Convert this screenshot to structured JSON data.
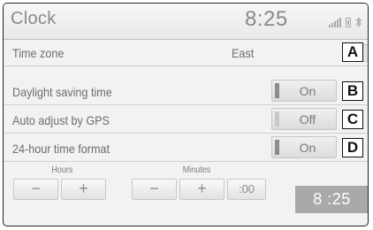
{
  "header": {
    "title": "Clock",
    "time": "8:25",
    "status_icons": [
      "signal-bars-icon",
      "phone-battery-icon",
      "bluetooth-icon"
    ]
  },
  "rows": [
    {
      "label": "Time zone",
      "value": "East",
      "callout": "A"
    },
    {
      "label": "Daylight saving time",
      "toggle": "On",
      "toggle_state": true,
      "callout": "B"
    },
    {
      "label": "Auto adjust by GPS",
      "toggle": "Off",
      "toggle_state": false,
      "callout": "C"
    },
    {
      "label": "24-hour time format",
      "toggle": "On",
      "toggle_state": true,
      "callout": "D"
    }
  ],
  "adjust": {
    "hours_label": "Hours",
    "minutes_label": "Minutes",
    "minus": "−",
    "plus": "+",
    "zero": ":00"
  },
  "display_time": "8 :25",
  "colors": {
    "background": "#f2f2f2",
    "indicator_on": "#8c8c8c",
    "indicator_off": "#c8c8c8",
    "display_bg": "#a9a9a9"
  }
}
